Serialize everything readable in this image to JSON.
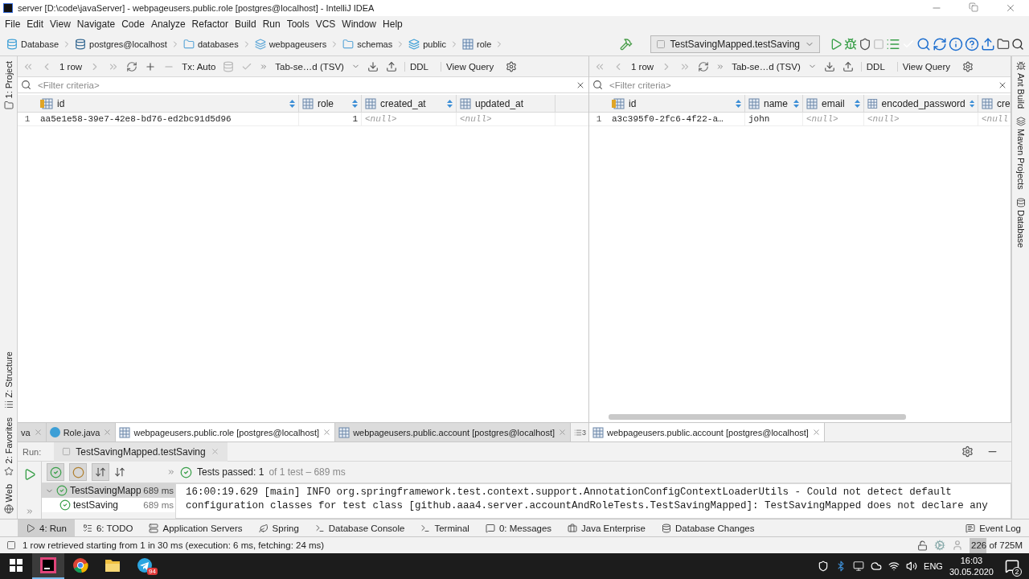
{
  "window": {
    "title": "server [D:\\code\\javaServer] - webpageusers.public.role [postgres@localhost] - IntelliJ IDEA"
  },
  "menu": [
    "File",
    "Edit",
    "View",
    "Navigate",
    "Code",
    "Analyze",
    "Refactor",
    "Build",
    "Run",
    "Tools",
    "VCS",
    "Window",
    "Help"
  ],
  "breadcrumb": [
    {
      "label": "Database",
      "kind": "database"
    },
    {
      "label": "postgres@localhost",
      "kind": "postgres"
    },
    {
      "label": "databases",
      "kind": "folder"
    },
    {
      "label": "webpageusers",
      "kind": "db"
    },
    {
      "label": "schemas",
      "kind": "folder"
    },
    {
      "label": "public",
      "kind": "schema"
    },
    {
      "label": "role",
      "kind": "table"
    }
  ],
  "run_config": "TestSavingMapped.testSaving",
  "left_strip": {
    "top": [
      {
        "label": "1: Project",
        "kind": "project"
      }
    ],
    "bottom": [
      {
        "label": "Z: Structure",
        "kind": "structure"
      },
      {
        "label": "2: Favorites",
        "kind": "favorites"
      },
      {
        "label": "Web",
        "kind": "web"
      }
    ]
  },
  "right_strip": [
    {
      "label": "Ant Build",
      "kind": "ant"
    },
    {
      "label": "Maven Projects",
      "kind": "maven"
    },
    {
      "label": "Database",
      "kind": "database"
    }
  ],
  "grids": [
    {
      "toolbar": {
        "rows": "1 row",
        "tx": "Tx: Auto",
        "format": "Tab-se…d (TSV)",
        "buttons": [
          "DDL",
          "View Query"
        ]
      },
      "filter": {
        "placeholder": "<Filter criteria>"
      },
      "columns": [
        {
          "name": "id",
          "kind": "primary-key"
        },
        {
          "name": "role",
          "kind": "column"
        },
        {
          "name": "created_at",
          "kind": "column"
        },
        {
          "name": "updated_at",
          "kind": "column"
        }
      ],
      "rows": [
        {
          "number": "1",
          "cells": [
            {
              "text": "aa5e1e58-39e7-42e8-bd76-ed2bc91d5d96",
              "kind": "text"
            },
            {
              "text": "1",
              "kind": "number"
            },
            {
              "text": "<null>",
              "kind": "null"
            },
            {
              "text": "<null>",
              "kind": "null"
            }
          ]
        }
      ]
    },
    {
      "toolbar": {
        "rows": "1 row",
        "format": "Tab-se…d (TSV)",
        "buttons": [
          "DDL",
          "View Query"
        ]
      },
      "filter": {
        "placeholder": "<Filter criteria>"
      },
      "columns": [
        {
          "name": "id",
          "kind": "primary-key"
        },
        {
          "name": "name",
          "kind": "column"
        },
        {
          "name": "email",
          "kind": "column"
        },
        {
          "name": "encoded_password",
          "kind": "column"
        },
        {
          "name": "cre",
          "kind": "column"
        }
      ],
      "rows": [
        {
          "number": "1",
          "cells": [
            {
              "text": "a3c395f0-2fc6-4f22-a…",
              "kind": "text"
            },
            {
              "text": "john",
              "kind": "text"
            },
            {
              "text": "<null>",
              "kind": "null"
            },
            {
              "text": "<null>",
              "kind": "null"
            },
            {
              "text": "<null",
              "kind": "null"
            }
          ]
        }
      ]
    }
  ],
  "editor": {
    "left_tabs": [
      {
        "label": "va",
        "kind": "java-cut",
        "selected": false
      },
      {
        "label": "Role.java",
        "kind": "java",
        "selected": false
      },
      {
        "label": "webpageusers.public.role [postgres@localhost]",
        "kind": "table",
        "selected": true
      },
      {
        "label": "webpageusers.public.account [postgres@localhost]",
        "kind": "table",
        "selected": false
      }
    ],
    "overflow_count": "3",
    "right_tabs": [
      {
        "label": "webpageusers.public.account [postgres@localhost]",
        "kind": "table",
        "selected": true
      }
    ]
  },
  "run": {
    "label": "Run:",
    "tab": "TestSavingMapped.testSaving",
    "summary": "Tests passed: 1",
    "detail": "of 1 test – 689 ms",
    "tree": [
      {
        "name": "TestSavingMapp",
        "time": "689 ms",
        "passed": true,
        "expanded": true,
        "children": [
          {
            "name": "testSaving",
            "time": "689 ms",
            "passed": true
          }
        ]
      }
    ],
    "console": [
      "16:00:19.629 [main] INFO org.springframework.test.context.support.AnnotationConfigContextLoaderUtils - Could not detect default",
      "configuration classes for test class [github.aaa4.server.accountAndRoleTests.TestSavingMapped]: TestSavingMapped does not declare any"
    ]
  },
  "tool_windows": [
    {
      "label": "4: Run",
      "kind": "run",
      "selected": true
    },
    {
      "label": "6: TODO",
      "kind": "todo",
      "selected": false
    },
    {
      "label": "Application Servers",
      "kind": "servers",
      "selected": false
    },
    {
      "label": "Spring",
      "kind": "spring",
      "selected": false
    },
    {
      "label": "Database Console",
      "kind": "console",
      "selected": false
    },
    {
      "label": "Terminal",
      "kind": "terminal",
      "selected": false
    },
    {
      "label": "0: Messages",
      "kind": "messages",
      "selected": false
    },
    {
      "label": "Java Enterprise",
      "kind": "enterprise",
      "selected": false
    },
    {
      "label": "Database Changes",
      "kind": "changes",
      "selected": false
    }
  ],
  "event_log": "Event Log",
  "status": {
    "message": "1 row retrieved starting from 1 in 30 ms (execution: 6 ms, fetching: 24 ms)",
    "memory": {
      "text": "226 of 725M",
      "level": 0.31
    }
  },
  "taskbar": {
    "apps": [
      {
        "kind": "intellij",
        "active": true
      },
      {
        "kind": "chrome",
        "active": false
      },
      {
        "kind": "explorer",
        "active": false
      },
      {
        "kind": "telegram",
        "active": false,
        "badge": "94"
      }
    ],
    "language": "ENG",
    "time": "16:03",
    "date": "30.05.2020",
    "notifications": "2"
  }
}
